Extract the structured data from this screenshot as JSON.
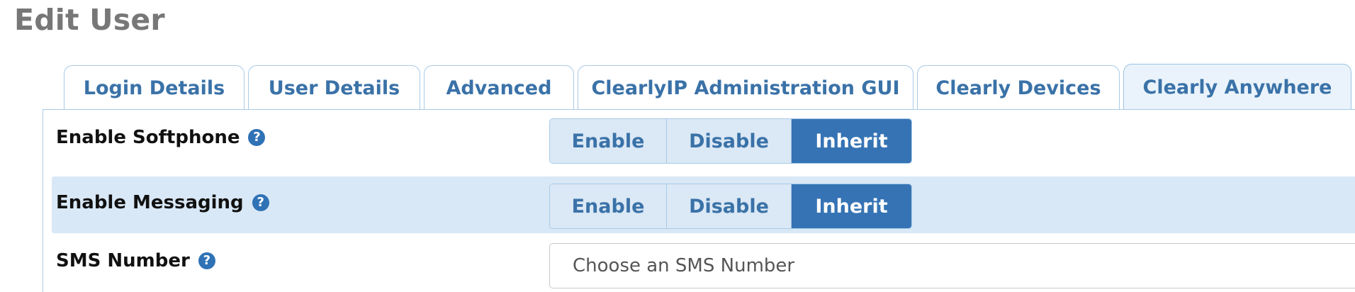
{
  "page": {
    "title": "Edit User"
  },
  "tabs": [
    {
      "label": "Login Details",
      "active": false
    },
    {
      "label": "User Details",
      "active": false
    },
    {
      "label": "Advanced",
      "active": false
    },
    {
      "label": "ClearlyIP Administration GUI",
      "active": false
    },
    {
      "label": "Clearly Devices",
      "active": false
    },
    {
      "label": "Clearly Anywhere",
      "active": true
    }
  ],
  "form": {
    "softphone": {
      "label": "Enable Softphone",
      "help": "?",
      "options": [
        "Enable",
        "Disable",
        "Inherit"
      ],
      "selected": "Inherit"
    },
    "messaging": {
      "label": "Enable Messaging",
      "help": "?",
      "options": [
        "Enable",
        "Disable",
        "Inherit"
      ],
      "selected": "Inherit"
    },
    "sms": {
      "label": "SMS Number",
      "help": "?",
      "placeholder": "Choose an SMS Number"
    }
  },
  "colors": {
    "accent": "#3573b4",
    "tab_text": "#3a72a8",
    "alt_row": "#d9e8f6",
    "title_gray": "#777777"
  },
  "icons": {
    "help": "question-circle-icon"
  }
}
